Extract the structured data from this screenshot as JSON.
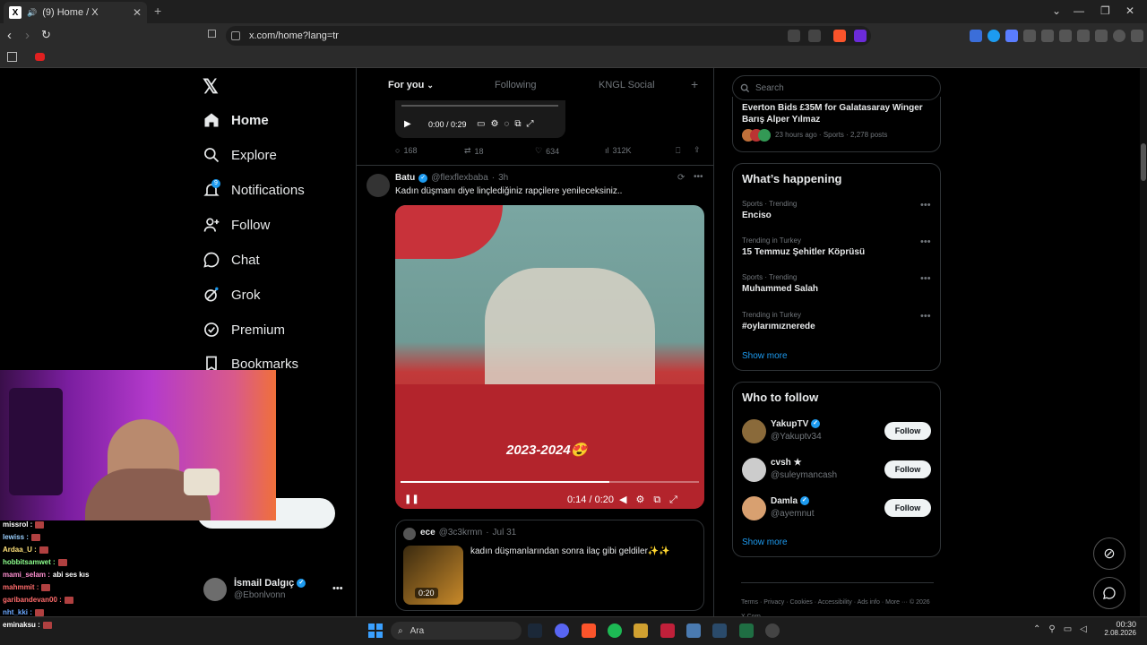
{
  "browser": {
    "tab_title": "(9) Home / X",
    "url": "x.com/home?lang=tr"
  },
  "nav": {
    "items": [
      {
        "label": "Home",
        "icon": "home-icon"
      },
      {
        "label": "Explore",
        "icon": "search-icon"
      },
      {
        "label": "Notifications",
        "icon": "bell-icon",
        "badge": "9"
      },
      {
        "label": "Follow",
        "icon": "person-add-icon"
      },
      {
        "label": "Chat",
        "icon": "chat-icon"
      },
      {
        "label": "Grok",
        "icon": "grok-icon"
      },
      {
        "label": "Premium",
        "icon": "premium-icon"
      },
      {
        "label": "Bookmarks",
        "icon": "bookmark-icon"
      }
    ]
  },
  "account": {
    "name": "İsmail Dalgıç",
    "handle": "@Ebonlvonn"
  },
  "feed_tabs": [
    "For you",
    "Following",
    "KNGL Social"
  ],
  "prev_post": {
    "video_time": "0:00 / 0:29",
    "replies": "168",
    "reposts": "18",
    "likes": "634",
    "views": "312K"
  },
  "post": {
    "author": "Batu",
    "handle": "@flexflexbaba",
    "time": "3h",
    "text": "Kadın düşmanı diye linçlediğiniz rapçilere yenileceksiniz..",
    "video_caption": "2023-2024😍",
    "video_time": "0:14 / 0:20",
    "quote": {
      "author": "ece",
      "handle": "@3c3krmn",
      "date": "Jul 31",
      "text": "kadın düşmanlarından sonra ilaç gibi geldiler✨✨",
      "duration": "0:20"
    }
  },
  "sidebar": {
    "search_placeholder": "Search",
    "top_story": {
      "title": "Everton Bids £35M for Galatasaray Winger Barış Alper Yılmaz",
      "meta": "23 hours ago · Sports · 2,278 posts"
    },
    "whats_happening_title": "What’s happening",
    "trends": [
      {
        "category": "Sports · Trending",
        "name": "Enciso"
      },
      {
        "category": "Trending in Turkey",
        "name": "15 Temmuz Şehitler Köprüsü"
      },
      {
        "category": "Sports · Trending",
        "name": "Muhammed Salah"
      },
      {
        "category": "Trending in Turkey",
        "name": "#oylarımıznerede"
      }
    ],
    "show_more": "Show more",
    "who_to_follow_title": "Who to follow",
    "follow_suggestions": [
      {
        "name": "YakupTV",
        "handle": "@Yakuptv34",
        "verified": true
      },
      {
        "name": "cvsh ★",
        "handle": "@suleymancash",
        "verified": false
      },
      {
        "name": "Damla",
        "handle": "@ayemnut",
        "verified": true
      }
    ],
    "follow_label": "Follow",
    "footer_links": [
      "Terms",
      "Privacy",
      "Cookies",
      "Accessibility",
      "Ads info",
      "More",
      "© 2026 X Corp."
    ]
  },
  "stream_chat": [
    {
      "user": "missrol :",
      "color": "#ffffff"
    },
    {
      "user": "lewiss :",
      "color": "#9ad0ff"
    },
    {
      "user": "Ardaa_U :",
      "color": "#ffe27a"
    },
    {
      "user": "hobbitsamwet :",
      "color": "#8dff8d"
    },
    {
      "user": "mami_selam :",
      "color": "#ff8fd0",
      "msg": "abi ses kıs"
    },
    {
      "user": "mahmmit :",
      "color": "#ff6b6b"
    },
    {
      "user": "garibandevan00 :",
      "color": "#ff6b6b"
    },
    {
      "user": "nht_kki :",
      "color": "#6ba8ff"
    },
    {
      "user": "eminaksu :",
      "color": "#ffffff"
    }
  ],
  "taskbar": {
    "search": "Ara",
    "time": "00:30",
    "date": "2.08.2026"
  },
  "colors": {
    "accent": "#1d9bf0",
    "background": "#000000",
    "muted": "#71767b"
  }
}
